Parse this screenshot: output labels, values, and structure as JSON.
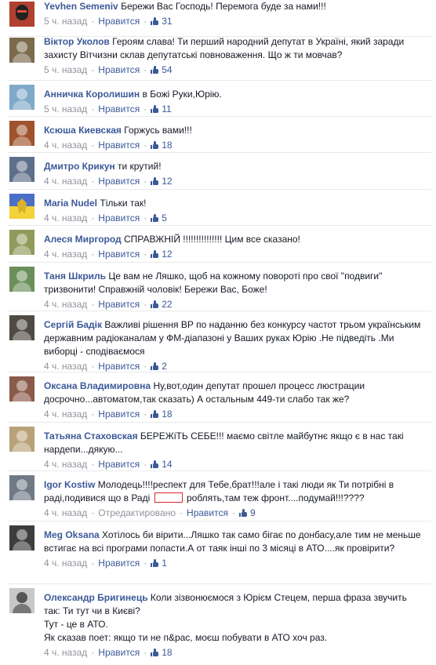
{
  "labels": {
    "like": "Нравится",
    "edited": "Отредактировано"
  },
  "colors": {
    "link": "#3b5998",
    "meta": "#90949c",
    "censor_box": "#e0202a"
  },
  "comments": [
    {
      "author": "Yevhen Semeniv",
      "text": "Бережи Вас Господь! Перемога буде за нами!!!",
      "time": "5 ч. назад",
      "likes": "31",
      "avatar": "masked-figure-avatar",
      "avatar_color": "#b04030"
    },
    {
      "author": "Віктор Уколов",
      "text": "Героям слава! Ти перший народний депутат в Україні, який заради захисту Вітчизни склав депутатські повноваження. Що ж ти мовчав?",
      "time": "5 ч. назад",
      "likes": "54",
      "avatar": "person-avatar",
      "avatar_color": "#7c6a4d"
    },
    {
      "author": "Анничка Королишин",
      "text": "в Божі Руки,Юрію.",
      "time": "5 ч. назад",
      "likes": "11",
      "avatar": "person-avatar",
      "avatar_color": "#7fa9c8"
    },
    {
      "author": "Ксюша Киевская",
      "text": "Горжусь вами!!!",
      "time": "4 ч. назад",
      "likes": "18",
      "avatar": "group-avatar",
      "avatar_color": "#a0522d"
    },
    {
      "author": "Дмитро Крикун",
      "text": "ти крутий!",
      "time": "4 ч. назад",
      "likes": "12",
      "avatar": "person-avatar",
      "avatar_color": "#5d6f8b"
    },
    {
      "author": "Maria Nudel",
      "text": "Тільки так!",
      "time": "4 ч. назад",
      "likes": "5",
      "avatar": "ukraine-flag-avatar",
      "avatar_color": "#4a6fc7"
    },
    {
      "author": "Алеся Миргород",
      "text": "СПРАВЖНІЙ !!!!!!!!!!!!!!! Цим все сказано!",
      "time": "4 ч. назад",
      "likes": "12",
      "avatar": "person-avatar",
      "avatar_color": "#8f9a5b"
    },
    {
      "author": "Таня Шкриль",
      "text": "Це вам не Ляшко, щоб на кожному повороті про свої \"подвиги\" тризвонити! Справжній чоловік! Бережи Вас, Боже!",
      "time": "4 ч. назад",
      "likes": "22",
      "avatar": "person-avatar",
      "avatar_color": "#6b8f5a"
    },
    {
      "author": "Сергій Бадік",
      "text": "Важливі рішення ВР по наданню без конкурсу частот трьом українським державним радіоканалам у ФМ-діапазоні у Ваших руках Юрію .Не підведіть .Ми виборці - сподіваємося",
      "time": "4 ч. назад",
      "likes": "2",
      "avatar": "person-avatar",
      "avatar_color": "#4f4a42"
    },
    {
      "author": "Оксана Владимировна",
      "text": "Ну,вот,один депутат прошел процесс люстрации досрочно...автоматом,так сказать) А остальным 449-ти слабо так же?",
      "time": "4 ч. назад",
      "likes": "18",
      "avatar": "person-avatar",
      "avatar_color": "#8a5a4a"
    },
    {
      "author": "Татьяна Стаховская",
      "text": "БЕРЕЖіТЬ СЕБЕ!!! маємо світле майбутнє якщо є в нас такі нардепи...дякую...",
      "time": "4 ч. назад",
      "likes": "14",
      "avatar": "landscape-avatar",
      "avatar_color": "#b9a27a"
    },
    {
      "author": "Igor Kostiw",
      "text_before": "Молодець!!!!респект для Тебе,брат!!!але і такі люди як Ти потрібні в раді,подивися що в Раді",
      "text_after": "роблять,там теж фронт....подумай!!!????",
      "time": "4 ч. назад",
      "edited": true,
      "likes": "9",
      "avatar": "person-avatar",
      "avatar_color": "#6f7a85"
    },
    {
      "author": "Meg Oksana",
      "text": "Хотілось би вірити...Ляшко так само бігає по донбасу,але тим не меньше встигає на всі програми попасти.А от таяк інші по 3 місяці в АТО....як провірити?",
      "time": "4 ч. назад",
      "likes": "1",
      "avatar": "person-avatar",
      "avatar_color": "#3d3d3d"
    },
    {
      "author": "Олександр Бригинець",
      "text_lines": [
        "Коли зізвонюємося з Юрієм Стецем, перша фраза звучить так: Ти тут чи в Києві?",
        "Тут - це в АТО.",
        "Як сказав поет: якщо ти не п&рас, моєш побувати в АТО хоч раз."
      ],
      "time": "4 ч. назад",
      "likes": "18",
      "avatar": "person-avatar",
      "avatar_color": "#c8c8c8"
    }
  ]
}
